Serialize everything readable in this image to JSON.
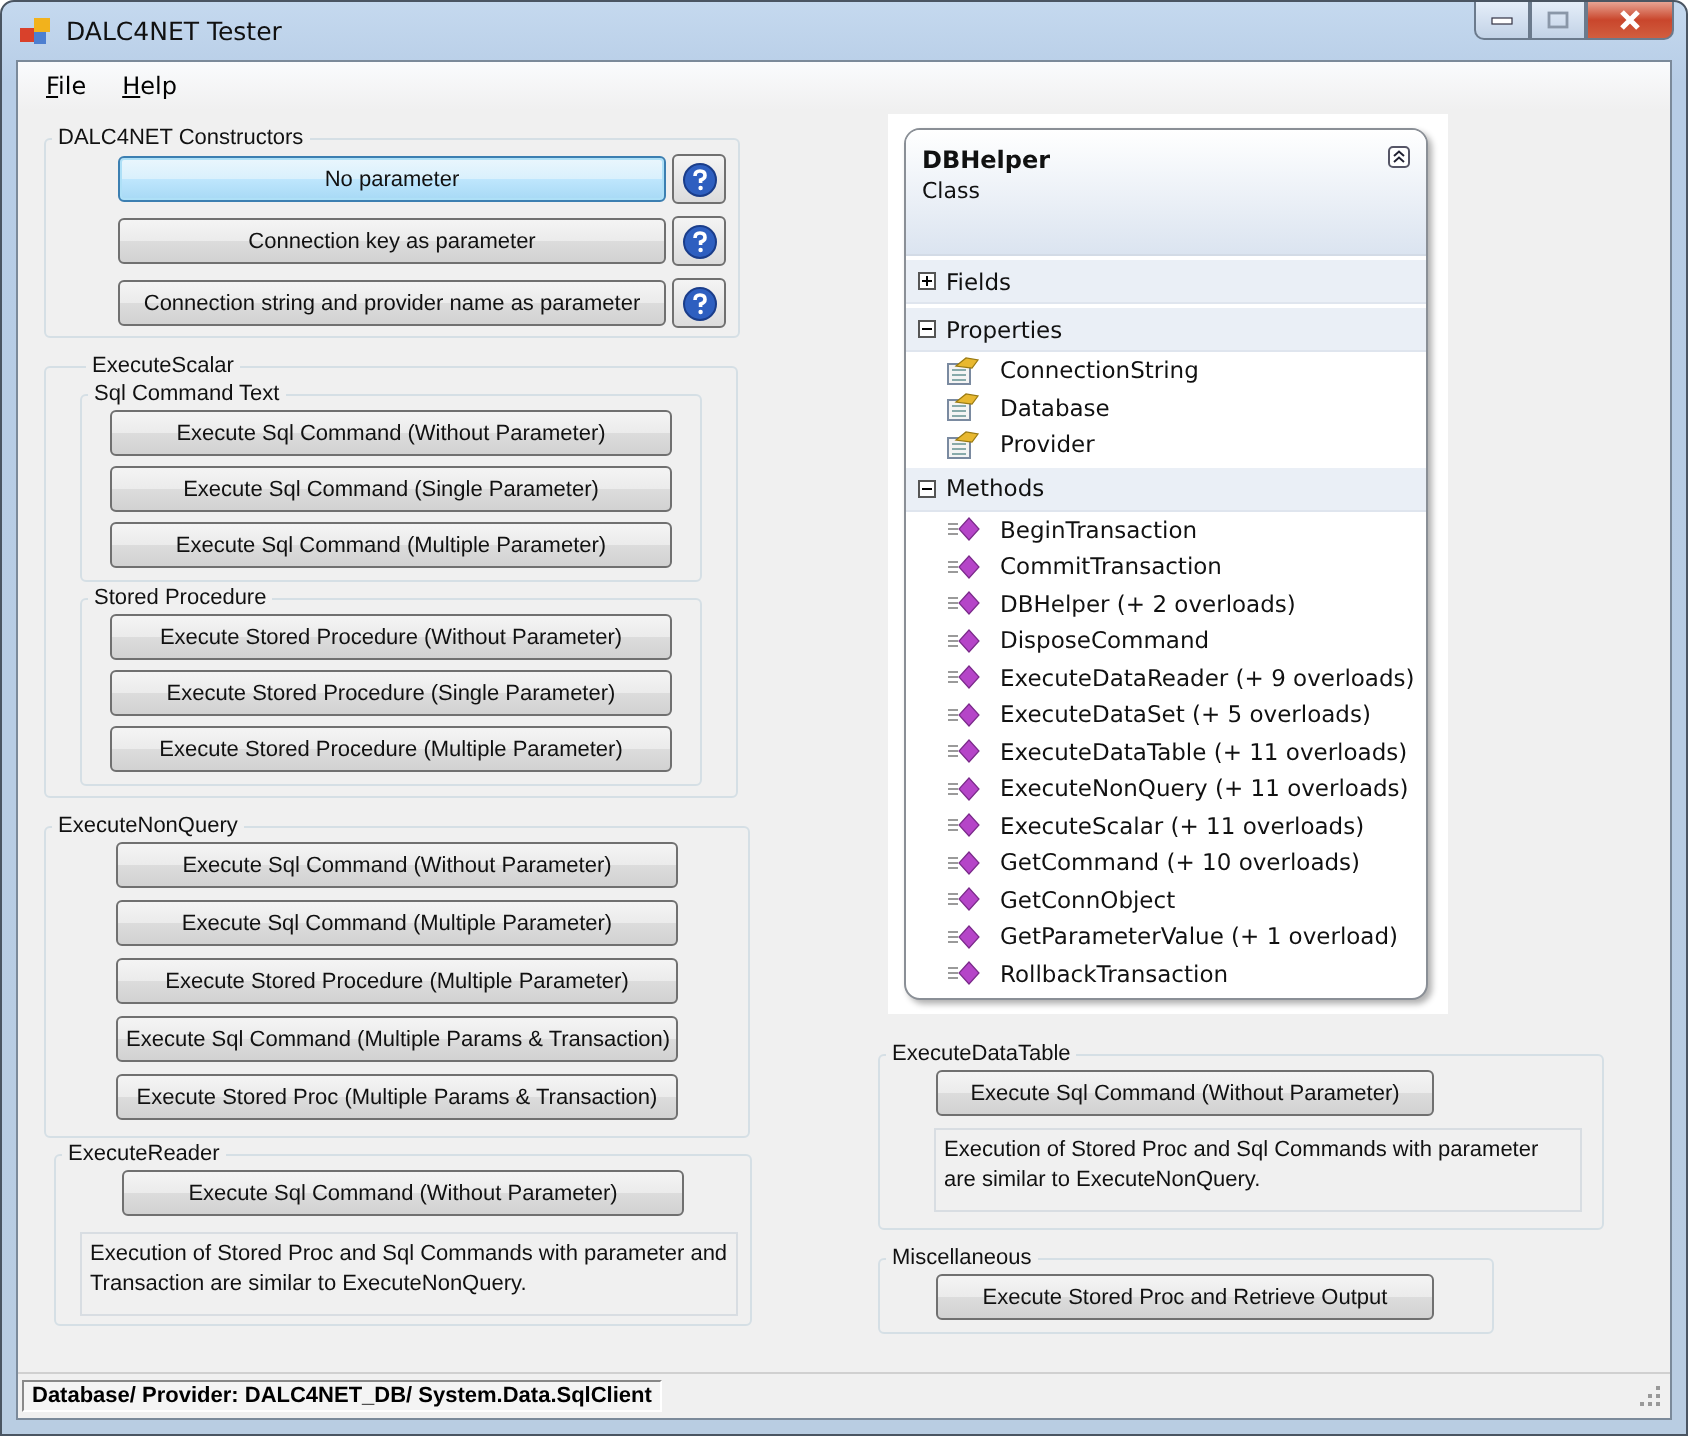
{
  "window": {
    "title": "DALC4NET Tester"
  },
  "menu": [
    {
      "label": "File"
    },
    {
      "label": "Help"
    }
  ],
  "left_groups": [
    {
      "title": "DALC4NET Constructors",
      "buttons": [
        {
          "label": "No parameter",
          "focused": true,
          "help": true
        },
        {
          "label": "Connection key as parameter",
          "focused": false,
          "help": true
        },
        {
          "label": "Connection string and provider name as parameter",
          "focused": false,
          "help": true
        }
      ]
    },
    {
      "title": "ExecuteScalar",
      "subgroups": [
        {
          "title": "Sql Command Text",
          "buttons": [
            {
              "label": "Execute Sql Command (Without Parameter)"
            },
            {
              "label": "Execute Sql Command (Single Parameter)"
            },
            {
              "label": "Execute Sql Command (Multiple Parameter)"
            }
          ]
        },
        {
          "title": "Stored Procedure",
          "buttons": [
            {
              "label": "Execute Stored Procedure (Without Parameter)"
            },
            {
              "label": "Execute Stored Procedure (Single Parameter)"
            },
            {
              "label": "Execute Stored Procedure (Multiple Parameter)"
            }
          ]
        }
      ]
    },
    {
      "title": "ExecuteNonQuery",
      "buttons": [
        {
          "label": "Execute Sql Command (Without Parameter)"
        },
        {
          "label": "Execute Sql Command (Multiple Parameter)"
        },
        {
          "label": "Execute Stored Procedure (Multiple Parameter)"
        },
        {
          "label": "Execute Sql Command (Multiple Params & Transaction)"
        },
        {
          "label": "Execute Stored Proc (Multiple Params & Transaction)"
        }
      ]
    },
    {
      "title": "ExecuteReader",
      "buttons": [
        {
          "label": "Execute Sql Command (Without Parameter)"
        }
      ],
      "note": "Execution of Stored Proc and Sql Commands with parameter and Transaction are similar to ExecuteNonQuery."
    }
  ],
  "class_diagram": {
    "name": "DBHelper",
    "type": "Class",
    "sections": [
      {
        "title": "Fields",
        "expanded": false
      },
      {
        "title": "Properties",
        "kind": "properties",
        "expanded": true,
        "members": [
          {
            "name": "ConnectionString"
          },
          {
            "name": "Database"
          },
          {
            "name": "Provider"
          }
        ]
      },
      {
        "title": "Methods",
        "kind": "methods",
        "expanded": true,
        "members": [
          {
            "name": "BeginTransaction"
          },
          {
            "name": "CommitTransaction"
          },
          {
            "name": "DBHelper (+ 2 overloads)"
          },
          {
            "name": "DisposeCommand"
          },
          {
            "name": "ExecuteDataReader (+ 9 overloads)"
          },
          {
            "name": "ExecuteDataSet (+ 5 overloads)"
          },
          {
            "name": "ExecuteDataTable (+ 11 overloads)"
          },
          {
            "name": "ExecuteNonQuery (+ 11 overloads)"
          },
          {
            "name": "ExecuteScalar (+ 11 overloads)"
          },
          {
            "name": "GetCommand (+ 10 overloads)"
          },
          {
            "name": "GetConnObject"
          },
          {
            "name": "GetParameterValue (+ 1 overload)"
          },
          {
            "name": "RollbackTransaction"
          }
        ]
      }
    ]
  },
  "right_groups": [
    {
      "title": "ExecuteDataTable",
      "buttons": [
        {
          "label": "Execute Sql Command (Without Parameter)"
        }
      ],
      "note": "Execution of Stored Proc and Sql Commands with parameter are similar to ExecuteNonQuery."
    },
    {
      "title": "Miscellaneous",
      "buttons": [
        {
          "label": "Execute Stored Proc and Retrieve Output"
        }
      ]
    }
  ],
  "status_bar": {
    "text": "Database/ Provider: DALC4NET_DB/ System.Data.SqlClient"
  }
}
